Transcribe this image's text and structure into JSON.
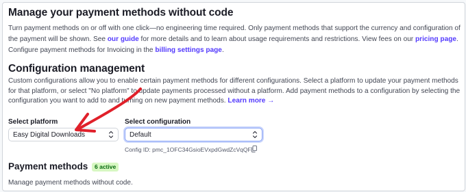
{
  "header": {
    "title": "Manage your payment methods without code",
    "desc_part1": "Turn payment methods on or off with one click—no engineering time required. Only payment methods that support the currency and configuration of the payment will be shown. See ",
    "guide_link": "our guide",
    "desc_part2": " for more details and to learn about usage requirements and restrictions. View fees on our ",
    "pricing_link": "pricing page",
    "desc_part3": ".",
    "invoicing_text": "Configure payment methods for Invoicing in the ",
    "billing_link": "billing settings page",
    "invoicing_end": "."
  },
  "config": {
    "title": "Configuration management",
    "desc": "Custom configurations allow you to enable certain payment methods for different configurations. Select a platform to update your payment methods for that platform, or select \"No platform\" to update payments processed without a platform. Add payment methods to a configuration by selecting the configuration you want to add to and turning on new payment methods.",
    "learn_more": "Learn more →",
    "platform_label": "Select platform",
    "platform_value": "Easy Digital Downloads",
    "configuration_label": "Select configuration",
    "configuration_value": "Default",
    "config_id": "Config ID: pmc_1OFC34GsioEVxpdGwdZcVqQF"
  },
  "payment_methods": {
    "title": "Payment methods",
    "badge": "6 active",
    "desc": "Manage payment methods without code."
  },
  "colors": {
    "link": "#533afd",
    "badge_bg": "#d7f7c2",
    "badge_text": "#05690d",
    "annotation_arrow": "#e0202a"
  },
  "icons": [
    "chevron-updown-icon",
    "copy-icon",
    "arrow-right-icon",
    "annotation-arrow"
  ]
}
